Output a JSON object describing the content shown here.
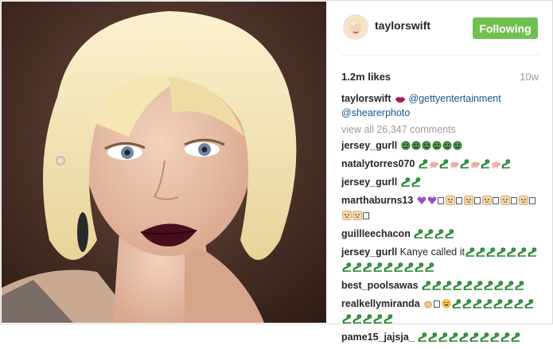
{
  "header": {
    "username": "taylorswift",
    "follow_label": "Following"
  },
  "meta": {
    "likes": "1.2m likes",
    "age": "10w"
  },
  "caption": {
    "username": "taylorswift",
    "emoji": "lips",
    "mention_1": "@gettyentertainment",
    "mention_2": "@shearerphoto"
  },
  "view_all": "view all 26,347 comments",
  "comments": [
    {
      "user": "jersey_gurll",
      "text": "",
      "emoji": [
        "snake-face",
        "snake-face",
        "snake-face",
        "snake-face",
        "snake-face",
        "snake-face"
      ]
    },
    {
      "user": "natalytorres070",
      "text": "",
      "emoji": [
        "snake",
        "pig",
        "snake",
        "pig",
        "snake",
        "pig",
        "snake",
        "pig",
        "snake"
      ]
    },
    {
      "user": "jersey_gurll",
      "text": "",
      "emoji": [
        "snake",
        "snake"
      ]
    },
    {
      "user": "marthaburns13",
      "text": "",
      "emoji": [
        "purple-heart",
        "purple-heart",
        "box",
        "face",
        "box",
        "face",
        "box",
        "face",
        "box",
        "face",
        "box",
        "face",
        "box",
        "face",
        "face",
        "box"
      ]
    },
    {
      "user": "guillleechacon",
      "text": "",
      "emoji": [
        "snake",
        "snake",
        "snake",
        "snake"
      ]
    },
    {
      "user": "jersey_gurll",
      "text": "Kanye called it",
      "emoji": [
        "snake",
        "snake",
        "snake",
        "snake",
        "snake",
        "snake",
        "snake",
        "snake",
        "snake",
        "snake",
        "snake",
        "snake",
        "snake",
        "snake",
        "snake",
        "snake"
      ]
    },
    {
      "user": "best_poolsawas",
      "text": "",
      "emoji": [
        "snake",
        "snake",
        "snake",
        "snake",
        "snake",
        "snake",
        "snake",
        "snake",
        "snake",
        "snake"
      ]
    },
    {
      "user": "realkellymiranda",
      "text": "",
      "emoji": [
        "hand",
        "box",
        "grin",
        "snake",
        "snake",
        "snake",
        "snake",
        "snake",
        "snake",
        "snake",
        "snake",
        "snake",
        "snake",
        "snake",
        "snake",
        "snake"
      ]
    },
    {
      "user": "pame15_jajsja_",
      "text": "",
      "emoji": [
        "snake",
        "snake",
        "snake",
        "snake",
        "snake",
        "snake",
        "snake",
        "snake",
        "snake",
        "snake"
      ]
    }
  ],
  "colors": {
    "follow_bg": "#70c050",
    "link": "#125688",
    "snake": "#2f8a3a",
    "lips": "#c2185b"
  }
}
